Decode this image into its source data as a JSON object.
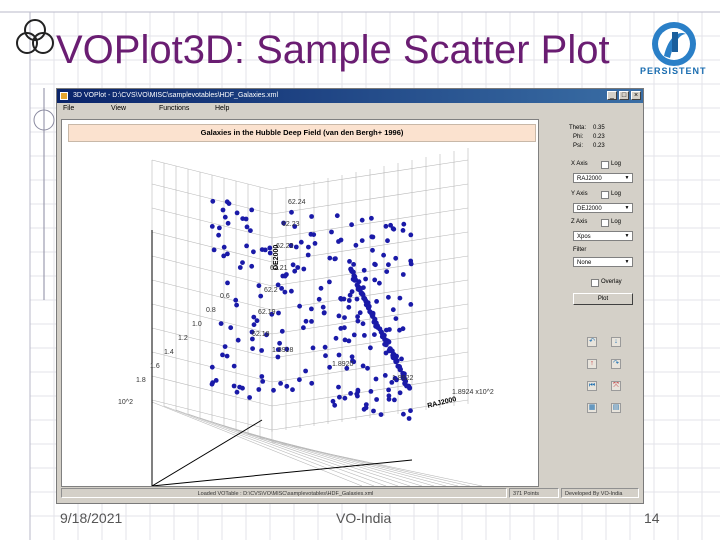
{
  "slide": {
    "title": "VOPlot3D: Sample Scatter Plot",
    "brand": "PERSISTENT",
    "footer_date": "9/18/2021",
    "footer_center": "VO-India",
    "footer_page": "14",
    "colors": {
      "title": "#6a1d72",
      "accent": "#1a6db0",
      "point": "#1a1aa8"
    }
  },
  "window": {
    "title": "3D VOPlot - D:\\CVS\\VO\\MISC\\samplevotables\\HDF_Galaxies.xml",
    "controls": [
      "_",
      "□",
      "×"
    ],
    "menu": [
      "File",
      "View",
      "Functions",
      "Help"
    ]
  },
  "plot": {
    "header": "Galaxies in the Hubble Deep Field (van den Bergh+ 1996)",
    "axis_z_label": "DE2000",
    "axis_x_label": "RAJ2000",
    "z_ticks": [
      "62.24",
      "62.23",
      "62.22",
      "62.21",
      "62.2",
      "62.19",
      "62.18"
    ],
    "x_ticks": [
      "1.8918",
      "1.8920",
      "1.8922",
      "1.8924 x10^2"
    ],
    "y_ticks": [
      "1.8",
      "1.6",
      "1.4",
      "1.2",
      "1.0",
      "0.8",
      "0.6"
    ],
    "y_exponent": "10^2"
  },
  "controls": {
    "theta": "Theta:",
    "theta_val": "0.35",
    "phi": "Phi:",
    "phi_val": "0.23",
    "psi": "Psi:",
    "psi_val": "0.23",
    "x_axis_label": "X Axis",
    "x_log": "Log",
    "x_combo": "RAJ2000",
    "y_axis_label": "Y Axis",
    "y_log": "Log",
    "y_combo": "DEJ2000",
    "z_axis_label": "Z Axis",
    "z_log": "Log",
    "z_combo": "Xpos",
    "filter_label": "Filter",
    "filter_combo": "None",
    "overlay_label": "Overlay",
    "plot_button": "Plot"
  },
  "status": {
    "left": "Loaded VOTable : D:\\CVS\\VO\\MISC\\samplevotables\\HDF_Galaxies.xml",
    "points": "371 Points",
    "right": "Developed By VO-India"
  }
}
